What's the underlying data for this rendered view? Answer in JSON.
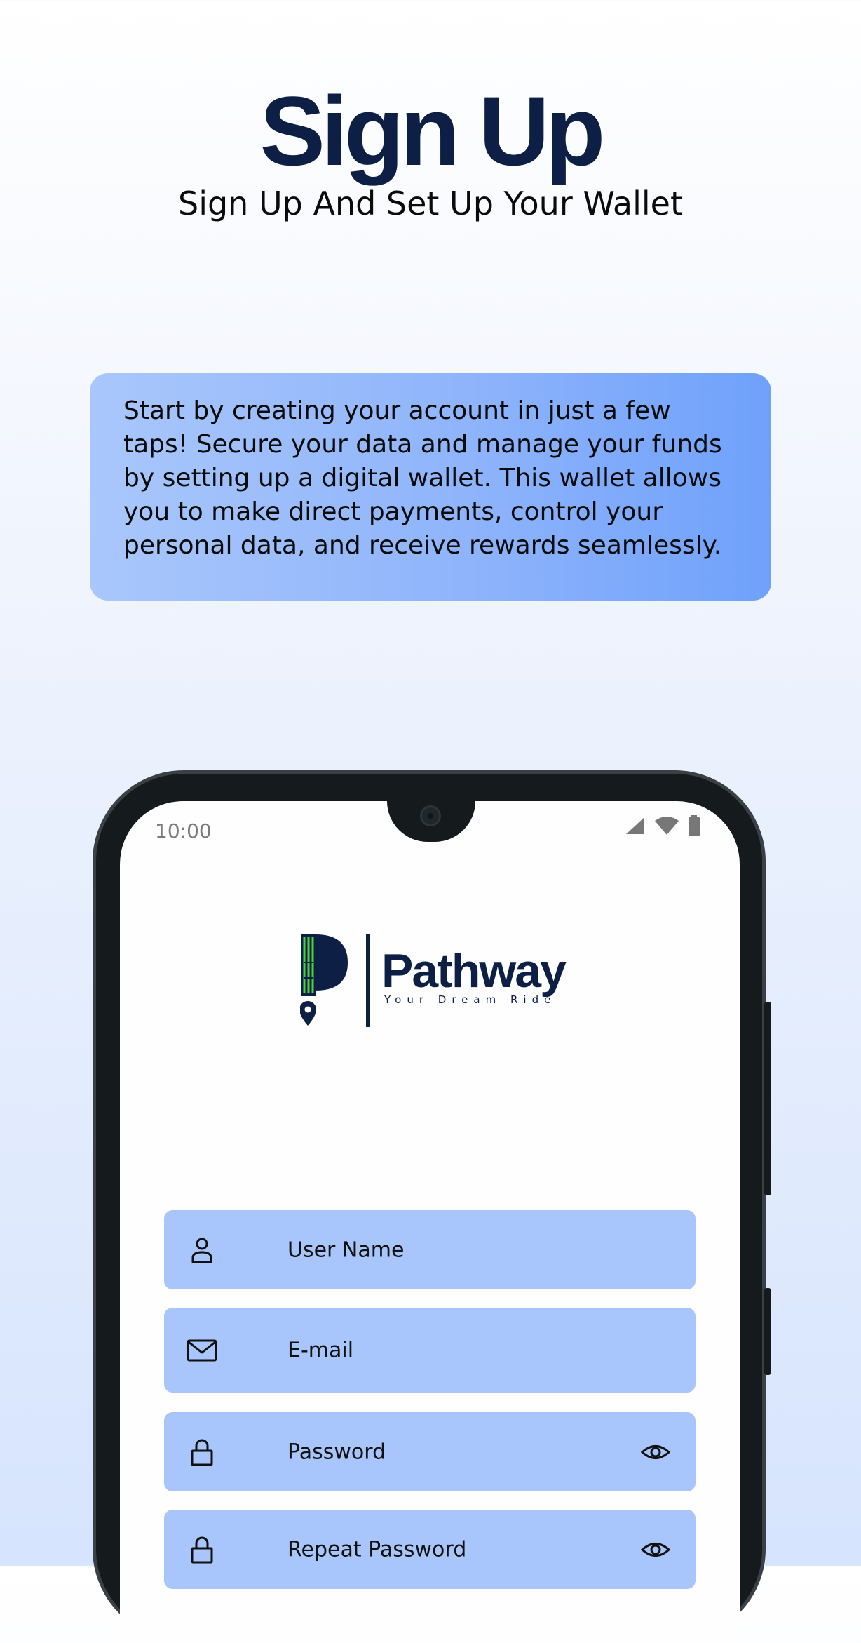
{
  "hero": {
    "title": "Sign Up",
    "subtitle": "Sign Up And Set Up Your Wallet"
  },
  "info": {
    "text_lines": [
      "Start by creating your account in just a few",
      "taps! Secure your data and manage your funds",
      "by setting up a digital wallet. This wallet allows",
      "you to make direct payments, control your",
      "personal data, and receive rewards seamlessly."
    ]
  },
  "phone": {
    "status_time": "10:00",
    "status_icons": [
      "signal-icon",
      "wifi-icon",
      "battery-icon"
    ],
    "logo": {
      "name": "Pathway",
      "tagline": "Your Dream Ride"
    },
    "form": {
      "fields": [
        {
          "label": "User Name",
          "icon": "user-icon"
        },
        {
          "label": "E-mail",
          "icon": "mail-icon"
        },
        {
          "label": "Password",
          "icon": "lock-icon",
          "toggle_icon": "eye-icon"
        },
        {
          "label": "Repeat Password",
          "icon": "lock-icon",
          "toggle_icon": "eye-icon"
        }
      ]
    }
  },
  "colors": {
    "navy": "#0d1f45",
    "field_bg": "#a8c6fc",
    "logo_green": "#4cd13a"
  }
}
